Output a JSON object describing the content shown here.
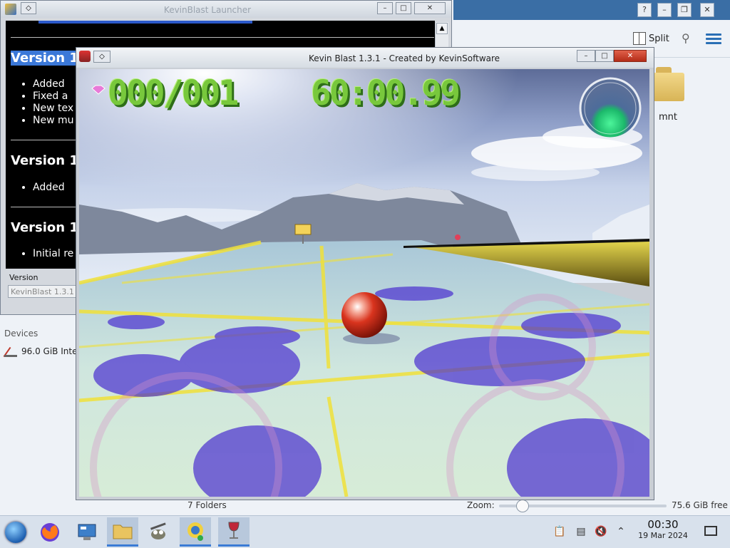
{
  "file_manager": {
    "split_label": "Split",
    "folder_name": "mnt",
    "devices_label": "Devices",
    "drive_label": "96.0 GiB Inte",
    "folders_count": "7 Folders",
    "zoom_label": "Zoom:",
    "free_space": "75.6 GiB free"
  },
  "launcher": {
    "title": "KevinBlast Launcher",
    "sections": [
      {
        "heading": "Version 1",
        "items": [
          "Added",
          "Fixed a",
          "New tex",
          "New mu"
        ]
      },
      {
        "heading": "Version 1",
        "items": [
          "Added"
        ]
      },
      {
        "heading": "Version 1",
        "items": [
          "Initial re"
        ]
      }
    ],
    "version_label": "Version",
    "version_value": "KevinBlast 1.3.1"
  },
  "game": {
    "title": "Kevin Blast 1.3.1 - Created by KevinSoftware",
    "hud": {
      "gems": "000/001",
      "timer": "60:00.99"
    }
  },
  "taskbar": {
    "time": "00:30",
    "date": "19 Mar 2024"
  },
  "icons": {
    "start": "windows-orb-icon",
    "firefox": "firefox-icon",
    "control_panel": "control-panel-icon",
    "file_manager": "folder-icon",
    "gimp": "gimp-icon",
    "kevinblast": "kevinblast-icon",
    "wine": "wine-glass-icon"
  }
}
